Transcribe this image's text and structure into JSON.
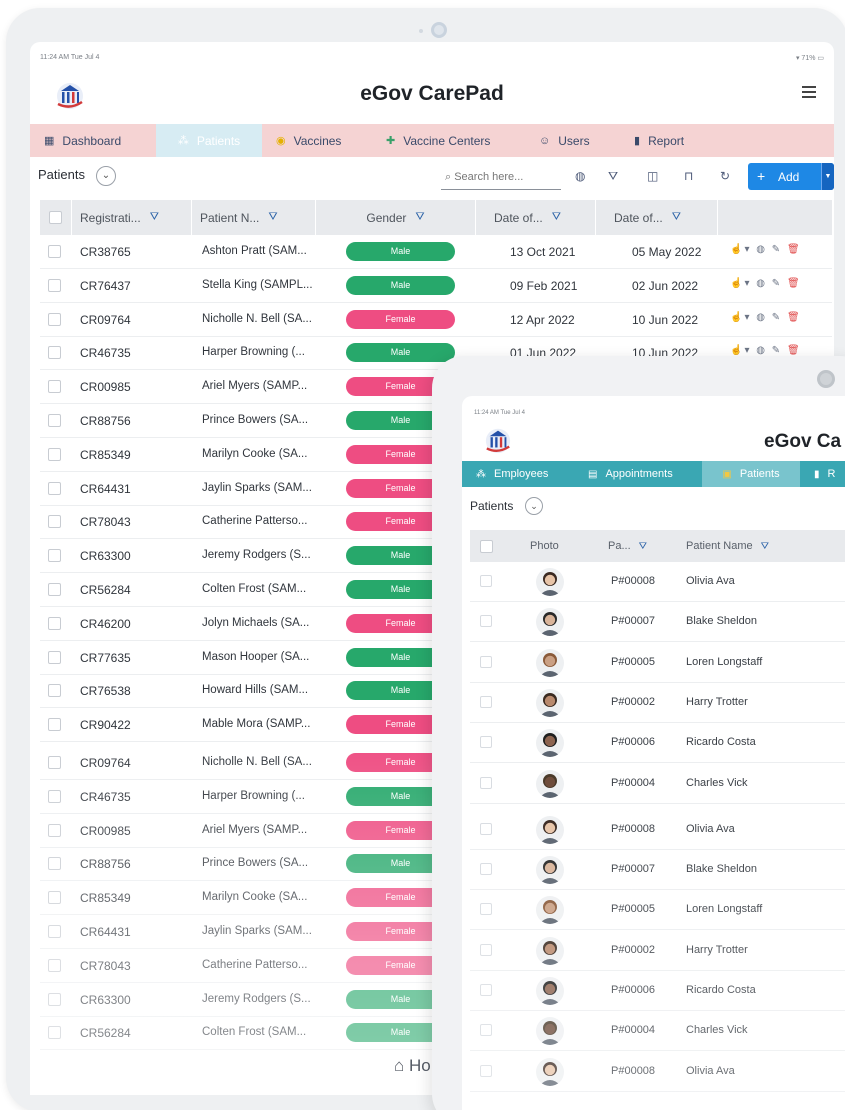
{
  "back": {
    "status_time": "11:24 AM  Tue Jul 4",
    "status_right": "▾ 71% ▭",
    "app_title": "eGov CarePad",
    "nav": [
      {
        "label": "Dashboard",
        "icon": "dashboard-icon"
      },
      {
        "label": "Patients",
        "icon": "patients-icon"
      },
      {
        "label": "Vaccines",
        "icon": "vaccine-icon"
      },
      {
        "label": "Vaccine Centers",
        "icon": "vaccine-center-icon"
      },
      {
        "label": "Users",
        "icon": "users-icon"
      },
      {
        "label": "Report",
        "icon": "report-icon"
      }
    ],
    "page_title": "Patients",
    "search_placeholder": "Search here...",
    "add_label": "Add",
    "columns": [
      "Registrati...",
      "Patient N...",
      "Gender",
      "Date of...",
      "Date of..."
    ],
    "rows": [
      {
        "reg": "CR38765",
        "name": "Ashton Pratt (SAM...",
        "gender": "Male",
        "d1": "13 Oct 2021",
        "d2": "05 May 2022"
      },
      {
        "reg": "CR76437",
        "name": "Stella King (SAMPL...",
        "gender": "Male",
        "d1": "09 Feb 2021",
        "d2": "02 Jun 2022"
      },
      {
        "reg": "CR09764",
        "name": "Nicholle N. Bell (SA...",
        "gender": "Female",
        "d1": "12 Apr 2022",
        "d2": "10 Jun 2022"
      },
      {
        "reg": "CR46735",
        "name": "Harper Browning (...",
        "gender": "Male",
        "d1": "01 Jun 2022",
        "d2": "10 Jun 2022"
      },
      {
        "reg": "CR00985",
        "name": "Ariel Myers (SAMP...",
        "gender": "Female",
        "d1": "",
        "d2": ""
      },
      {
        "reg": "CR88756",
        "name": "Prince Bowers (SA...",
        "gender": "Male",
        "d1": "",
        "d2": ""
      },
      {
        "reg": "CR85349",
        "name": "Marilyn Cooke (SA...",
        "gender": "Female",
        "d1": "",
        "d2": ""
      },
      {
        "reg": "CR64431",
        "name": "Jaylin Sparks (SAM...",
        "gender": "Female",
        "d1": "",
        "d2": ""
      },
      {
        "reg": "CR78043",
        "name": "Catherine Patterso...",
        "gender": "Female",
        "d1": "",
        "d2": ""
      },
      {
        "reg": "CR63300",
        "name": "Jeremy Rodgers (S...",
        "gender": "Male",
        "d1": "",
        "d2": ""
      },
      {
        "reg": "CR56284",
        "name": "Colten Frost (SAM...",
        "gender": "Male",
        "d1": "",
        "d2": ""
      },
      {
        "reg": "CR46200",
        "name": "Jolyn Michaels (SA...",
        "gender": "Female",
        "d1": "",
        "d2": ""
      },
      {
        "reg": "CR77635",
        "name": "Mason Hooper (SA...",
        "gender": "Male",
        "d1": "",
        "d2": ""
      },
      {
        "reg": "CR76538",
        "name": "Howard Hills (SAM...",
        "gender": "Male",
        "d1": "",
        "d2": ""
      },
      {
        "reg": "CR90422",
        "name": "Mable Mora (SAMP...",
        "gender": "Female",
        "d1": "",
        "d2": ""
      },
      {
        "reg": "CR09764",
        "name": "Nicholle N. Bell (SA...",
        "gender": "Female",
        "d1": "",
        "d2": ""
      },
      {
        "reg": "CR46735",
        "name": "Harper Browning (...",
        "gender": "Male",
        "d1": "",
        "d2": ""
      },
      {
        "reg": "CR00985",
        "name": "Ariel Myers (SAMP...",
        "gender": "Female",
        "d1": "",
        "d2": ""
      },
      {
        "reg": "CR88756",
        "name": "Prince Bowers (SA...",
        "gender": "Male",
        "d1": "",
        "d2": ""
      },
      {
        "reg": "CR85349",
        "name": "Marilyn Cooke (SA...",
        "gender": "Female",
        "d1": "",
        "d2": ""
      },
      {
        "reg": "CR64431",
        "name": "Jaylin Sparks (SAM...",
        "gender": "Female",
        "d1": "",
        "d2": ""
      },
      {
        "reg": "CR78043",
        "name": "Catherine Patterso...",
        "gender": "Female",
        "d1": "",
        "d2": ""
      },
      {
        "reg": "CR63300",
        "name": "Jeremy Rodgers (S...",
        "gender": "Male",
        "d1": "",
        "d2": ""
      },
      {
        "reg": "CR56284",
        "name": "Colten Frost (SAM...",
        "gender": "Male",
        "d1": "",
        "d2": ""
      }
    ],
    "home_label": "Ho"
  },
  "front": {
    "status_time": "11:24 AM  Tue Jul 4",
    "app_title": "eGov Ca",
    "nav": [
      {
        "label": "Employees",
        "icon": "employees-icon"
      },
      {
        "label": "Appointments",
        "icon": "calendar-icon"
      },
      {
        "label": "Patients",
        "icon": "patients-icon"
      },
      {
        "label": "R",
        "icon": "report-icon"
      }
    ],
    "page_title": "Patients",
    "columns": [
      "Photo",
      "Pa...",
      "Patient Name"
    ],
    "rows": [
      {
        "pid": "P#00008",
        "name": "Olivia Ava"
      },
      {
        "pid": "P#00007",
        "name": "Blake Sheldon"
      },
      {
        "pid": "P#00005",
        "name": "Loren Longstaff"
      },
      {
        "pid": "P#00002",
        "name": "Harry Trotter"
      },
      {
        "pid": "P#00006",
        "name": "Ricardo Costa"
      },
      {
        "pid": "P#00004",
        "name": "Charles Vick"
      },
      {
        "pid": "P#00008",
        "name": "Olivia Ava"
      },
      {
        "pid": "P#00007",
        "name": "Blake Sheldon"
      },
      {
        "pid": "P#00005",
        "name": "Loren Longstaff"
      },
      {
        "pid": "P#00002",
        "name": "Harry Trotter"
      },
      {
        "pid": "P#00006",
        "name": "Ricardo Costa"
      },
      {
        "pid": "P#00004",
        "name": "Charles Vick"
      },
      {
        "pid": "P#00008",
        "name": "Olivia Ava"
      }
    ]
  },
  "colors": {
    "male": "#27a86b",
    "female": "#ee4d82",
    "nav_back": "#f5d3d3",
    "nav_front": "#3aa7b3",
    "primary": "#1e88e5"
  }
}
